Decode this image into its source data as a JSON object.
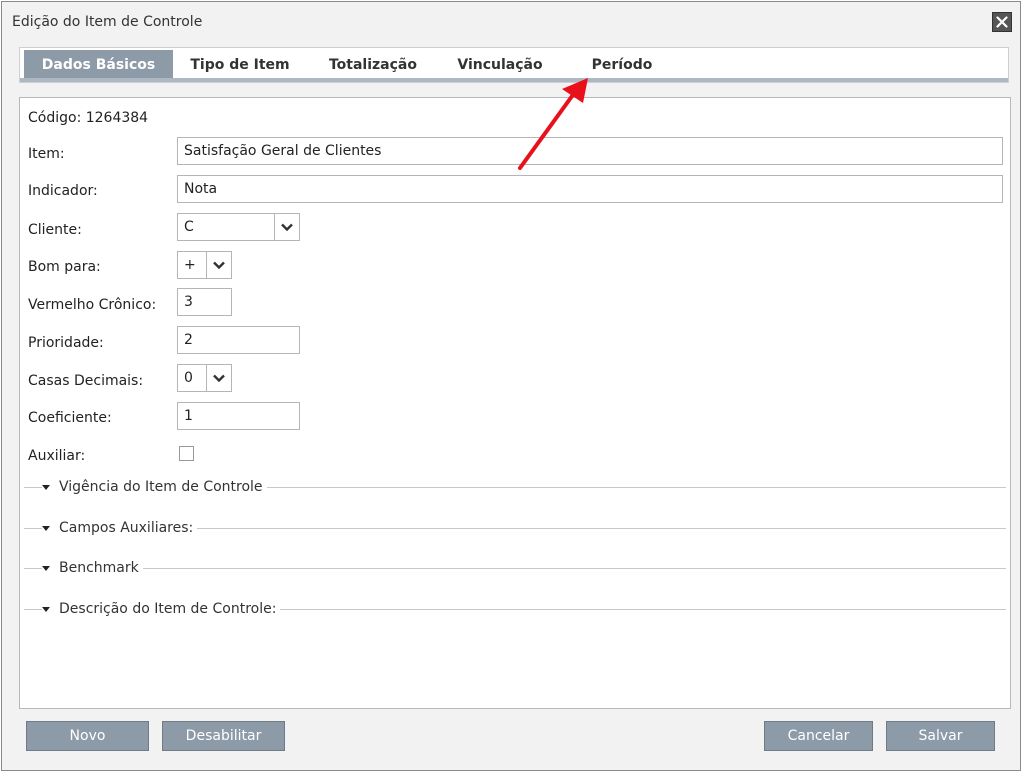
{
  "window": {
    "title": "Edição do Item de Controle"
  },
  "tabs": [
    "Dados Básicos",
    "Tipo de Item",
    "Totalização",
    "Vinculação",
    "Período"
  ],
  "form": {
    "codigo": "Código: 1264384",
    "item_label": "Item:",
    "item_value": "Satisfação Geral de Clientes",
    "indicador_label": "Indicador:",
    "indicador_value": "Nota",
    "cliente_label": "Cliente:",
    "cliente_value": "C",
    "bom_para_label": "Bom para:",
    "bom_para_value": "+",
    "vermelho_label": "Vermelho Crônico:",
    "vermelho_value": "3",
    "prioridade_label": "Prioridade:",
    "prioridade_value": "2",
    "casas_label": "Casas Decimais:",
    "casas_value": "0",
    "coeficiente_label": "Coeficiente:",
    "coeficiente_value": "1",
    "auxiliar_label": "Auxiliar:",
    "auxiliar_checked": false
  },
  "sections": [
    "Vigência do Item de Controle",
    "Campos Auxiliares:",
    "Benchmark",
    "Descrição do Item de Controle:"
  ],
  "buttons": {
    "novo": "Novo",
    "desabilitar": "Desabilitar",
    "cancelar": "Cancelar",
    "salvar": "Salvar"
  },
  "colors": {
    "accent": "#8d9aa7",
    "annotation_arrow": "#e8101a"
  }
}
